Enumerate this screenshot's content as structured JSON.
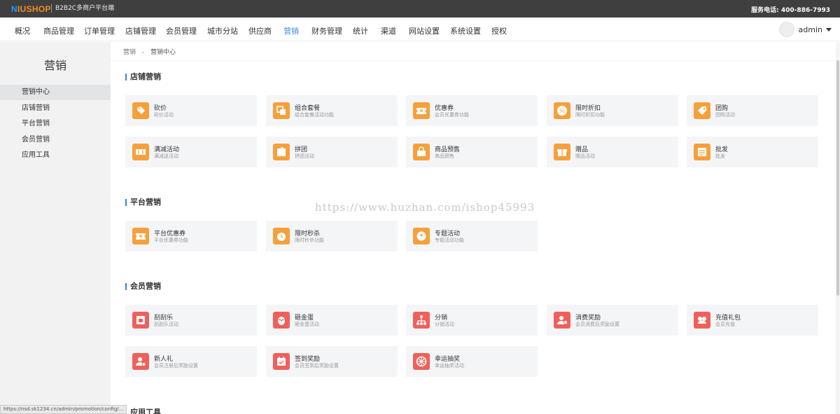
{
  "topbar": {
    "logo_n": "N",
    "logo_rest": "IUSHOP",
    "subtitle": "B2B2C多商户平台端",
    "phone": "服务电话:  400-886-7993"
  },
  "nav": {
    "items": [
      "概况",
      "商品管理",
      "订单管理",
      "店铺管理",
      "会员管理",
      "城市分站",
      "供应商",
      "营销",
      "财务管理",
      "统计",
      "渠道",
      "网站设置",
      "系统设置",
      "授权"
    ],
    "active_color": "#3f87e8",
    "user": "admin"
  },
  "sidebar": {
    "title": "营销",
    "items": [
      "营销中心",
      "店铺营销",
      "平台营销",
      "会员营销",
      "应用工具"
    ]
  },
  "breadcrumb": {
    "parent": "营销",
    "separator": "-",
    "current": "营销中心"
  },
  "sections": [
    {
      "title": "店铺营销",
      "cards": [
        {
          "title": "砍价",
          "desc": "砍价活动",
          "icon": "bargain-icon",
          "color": "orange"
        },
        {
          "title": "组合套餐",
          "desc": "组合套餐活动功能",
          "icon": "bundle-icon",
          "color": "orange"
        },
        {
          "title": "优惠券",
          "desc": "会员优惠券功能",
          "icon": "coupon-icon",
          "color": "orange"
        },
        {
          "title": "限时折扣",
          "desc": "限时折扣功能",
          "icon": "discount-icon",
          "color": "orange"
        },
        {
          "title": "团购",
          "desc": "团购活动",
          "icon": "groupbuy-icon",
          "color": "orange"
        },
        {
          "title": "满减活动",
          "desc": "满减送活动",
          "icon": "full-reduction-icon",
          "color": "orange"
        },
        {
          "title": "拼团",
          "desc": "拼团活动",
          "icon": "puzzle-icon",
          "color": "orange"
        },
        {
          "title": "商品预售",
          "desc": "商品预售",
          "icon": "presale-icon",
          "color": "orange"
        },
        {
          "title": "赠品",
          "desc": "赠品活动",
          "icon": "gift-icon",
          "color": "orange"
        },
        {
          "title": "批发",
          "desc": "批发",
          "icon": "wholesale-icon",
          "color": "orange"
        }
      ]
    },
    {
      "title": "平台营销",
      "cards": [
        {
          "title": "平台优惠券",
          "desc": "平台优惠券功能",
          "icon": "coupon-icon",
          "color": "orange"
        },
        {
          "title": "限时秒杀",
          "desc": "限时秒杀功能",
          "icon": "alarm-clock-icon",
          "color": "orange"
        },
        {
          "title": "专题活动",
          "desc": "专题活动功能",
          "icon": "topic-icon",
          "color": "orange"
        }
      ]
    },
    {
      "title": "会员营销",
      "cards": [
        {
          "title": "刮刮乐",
          "desc": "刮刮乐活动",
          "icon": "scratch-card-icon",
          "color": "red"
        },
        {
          "title": "砸金蛋",
          "desc": "砸金蛋活动",
          "icon": "golden-egg-icon",
          "color": "red"
        },
        {
          "title": "分销",
          "desc": "分销活动",
          "icon": "distribution-icon",
          "color": "red"
        },
        {
          "title": "消费奖励",
          "desc": "会员消费后奖励设置",
          "icon": "consume-reward-icon",
          "color": "red"
        },
        {
          "title": "充值礼包",
          "desc": "会员充值",
          "icon": "recharge-gift-icon",
          "color": "red"
        },
        {
          "title": "新人礼",
          "desc": "会员注册后奖励设置",
          "icon": "newcomer-icon",
          "color": "red"
        },
        {
          "title": "签到奖励",
          "desc": "会员签到后奖励设置",
          "icon": "signin-icon",
          "color": "red"
        },
        {
          "title": "幸运抽奖",
          "desc": "幸运抽奖活动",
          "icon": "lucky-wheel-icon",
          "color": "red"
        }
      ]
    },
    {
      "title": "应用工具",
      "cards": []
    }
  ],
  "watermark": "https://www.huzhan.com/ishop45993",
  "statusbar": "https://nsd.sk1234.cn/admin/promotion/config/..."
}
